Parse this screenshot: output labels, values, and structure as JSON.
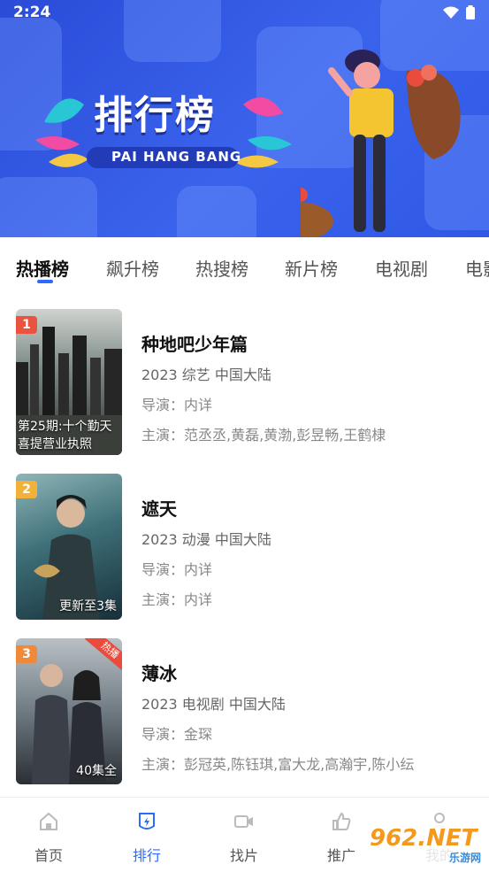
{
  "status": {
    "time": "2:24"
  },
  "banner": {
    "title": "排行榜",
    "subtitle": "PAI HANG BANG"
  },
  "tabs": [
    {
      "label": "热播榜",
      "active": true
    },
    {
      "label": "飙升榜"
    },
    {
      "label": "热搜榜"
    },
    {
      "label": "新片榜"
    },
    {
      "label": "电视剧"
    },
    {
      "label": "电影"
    }
  ],
  "items": [
    {
      "rank": "1",
      "title": "种地吧少年篇",
      "meta": "2023  综艺  中国大陆",
      "director": "导演：内详",
      "cast": "主演：范丞丞,黄磊,黄渤,彭昱畅,王鹤棣",
      "poster_caption": "第25期:十个勤天\n喜提营业执照",
      "rank_color": "#e9533f"
    },
    {
      "rank": "2",
      "title": "遮天",
      "meta": "2023  动漫  中国大陆",
      "director": "导演：内详",
      "cast": "主演：内详",
      "poster_caption": "更新至3集",
      "rank_color": "#f2b23a"
    },
    {
      "rank": "3",
      "title": "薄冰",
      "meta": "2023  电视剧  中国大陆",
      "director": "导演：金琛",
      "cast": "主演：彭冠英,陈钰琪,富大龙,高瀚宇,陈小纭",
      "poster_caption": "40集全",
      "rank_color": "#f08a3a",
      "badge": "热播"
    }
  ],
  "nav": [
    {
      "label": "首页",
      "icon": "home-icon"
    },
    {
      "label": "排行",
      "icon": "rank-icon",
      "active": true
    },
    {
      "label": "找片",
      "icon": "video-icon"
    },
    {
      "label": "推广",
      "icon": "thumbs-up-icon"
    },
    {
      "label": "我的",
      "icon": "user-icon"
    }
  ],
  "watermark": {
    "text": "962.NET",
    "sub": "乐游网"
  },
  "colors": {
    "accent": "#2b6bff",
    "banner": "#3a63ec"
  }
}
